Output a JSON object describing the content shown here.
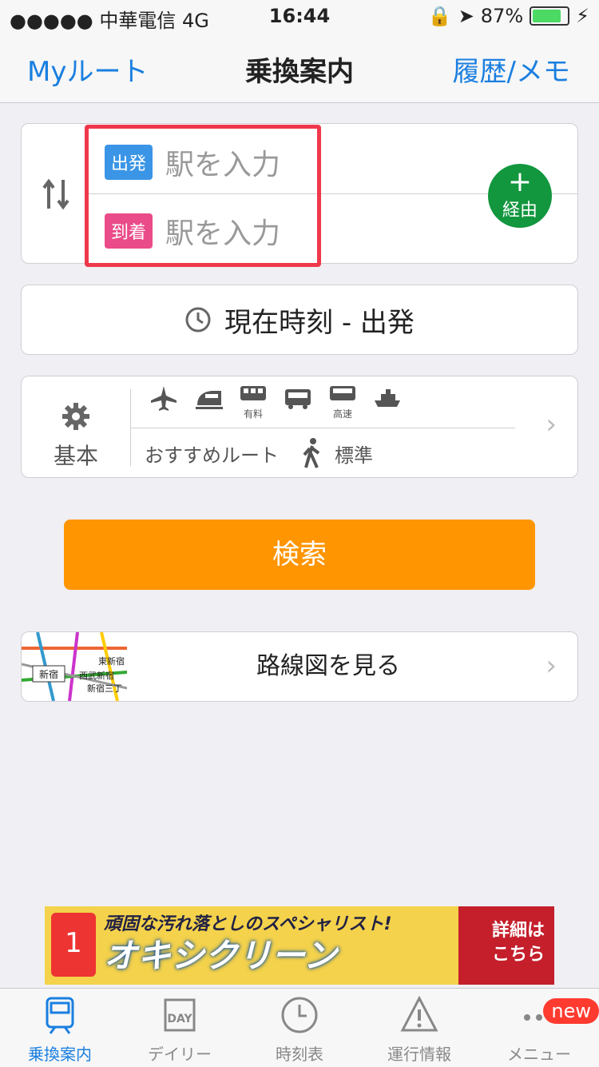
{
  "status": {
    "carrier": "●●●●● 中華電信  4G",
    "time": "16:44",
    "battery": "87%",
    "battery_level": 0.87
  },
  "nav": {
    "left": "Myルート",
    "title": "乗換案内",
    "right": "履歴/メモ"
  },
  "route": {
    "departure_tag": "出発",
    "departure_placeholder": "駅を入力",
    "arrival_tag": "到着",
    "arrival_placeholder": "駅を入力",
    "via_label": "経由"
  },
  "time_setting": "現在時刻 - 出発",
  "options": {
    "basic_label": "基本",
    "modes": [
      {
        "icon": "airplane-icon",
        "sub": ""
      },
      {
        "icon": "shinkansen-icon",
        "sub": ""
      },
      {
        "icon": "paid-train-icon",
        "sub": "有料"
      },
      {
        "icon": "bus-icon",
        "sub": ""
      },
      {
        "icon": "highway-bus-icon",
        "sub": "高速"
      },
      {
        "icon": "ferry-icon",
        "sub": ""
      }
    ],
    "route_type": "おすすめルート",
    "walk_speed": "標準"
  },
  "search_button": "検索",
  "map": {
    "label": "路線図を見る",
    "thumb_labels": [
      "新宿",
      "西武新宿",
      "東新宿",
      "新宿三丁"
    ]
  },
  "ad": {
    "headline": "頑固な汚れ落としのスペシャリスト!",
    "brand": "オキシクリーン",
    "cta_line1": "詳細は",
    "cta_line2": "こちら"
  },
  "tabs": [
    {
      "label": "乗換案内",
      "icon": "train-icon",
      "active": true
    },
    {
      "label": "デイリー",
      "icon": "daily-calendar-icon",
      "active": false
    },
    {
      "label": "時刻表",
      "icon": "clock-icon",
      "active": false
    },
    {
      "label": "運行情報",
      "icon": "warning-icon",
      "active": false
    },
    {
      "label": "メニュー",
      "icon": "more-icon",
      "active": false
    }
  ],
  "menu_badge": "new",
  "colors": {
    "accent": "#1a7fe0",
    "search": "#ff9500",
    "via": "#12963e",
    "departure": "#3b95e6",
    "arrival": "#ea4c89",
    "highlight": "#f0384b"
  }
}
